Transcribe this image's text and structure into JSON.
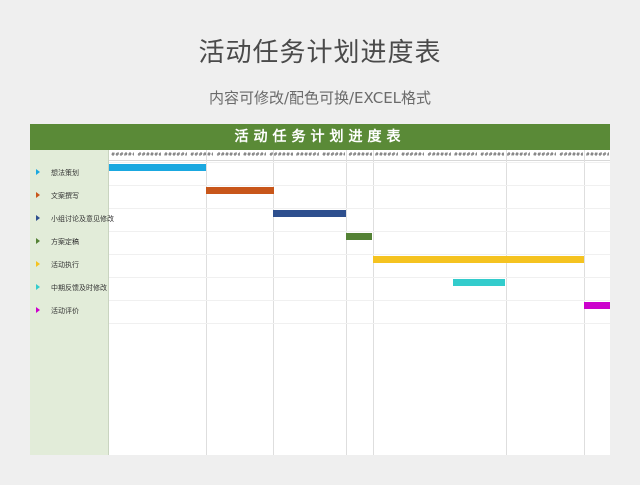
{
  "page": {
    "title": "活动任务计划进度表",
    "subtitle": "内容可修改/配色可换/EXCEL格式"
  },
  "sheet": {
    "header": "活动任务计划进度表",
    "date_placeholder": "######",
    "date_column_count": 19
  },
  "tasks": [
    {
      "name": "想法策划",
      "color": "#1aa8e0",
      "start": 0,
      "end": 1.85
    },
    {
      "name": "文案撰写",
      "color": "#c8561a",
      "start": 1.85,
      "end": 3.15
    },
    {
      "name": "小组讨论及意见修改",
      "color": "#2e4f8e",
      "start": 3.15,
      "end": 4.55
    },
    {
      "name": "方案定稿",
      "color": "#548235",
      "start": 4.55,
      "end": 5.05
    },
    {
      "name": "活动执行",
      "color": "#f5c320",
      "start": 5.05,
      "end": 9.1
    },
    {
      "name": "中期反馈及时修改",
      "color": "#33cccc",
      "start": 6.6,
      "end": 7.6
    },
    {
      "name": "活动评价",
      "color": "#cc00cc",
      "start": 9.1,
      "end": 9.6
    }
  ],
  "gantt": {
    "total_units": 9.6,
    "milestones": [
      1.85,
      3.15,
      4.55,
      5.05,
      7.6,
      9.1
    ]
  }
}
